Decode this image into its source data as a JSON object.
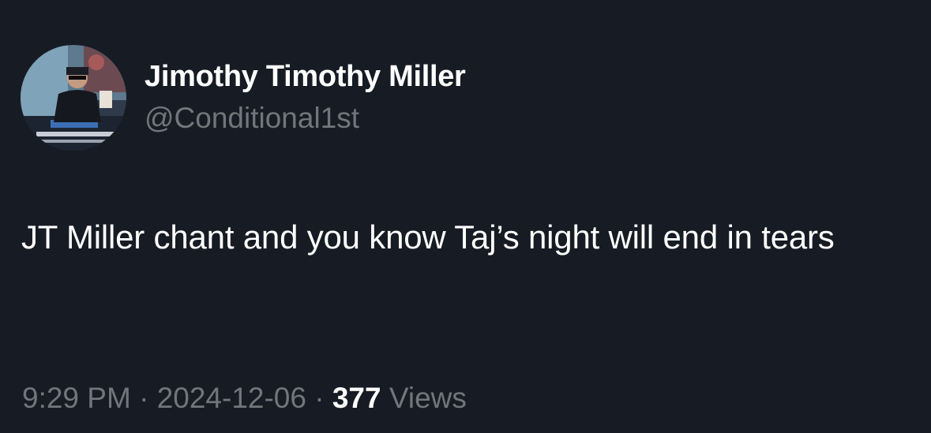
{
  "author": {
    "display_name": "Jimothy Timothy Miller",
    "handle": "@Conditional1st"
  },
  "tweet": {
    "text": "JT Miller chant and you know Taj’s night will end in tears"
  },
  "meta": {
    "time": "9:29 PM",
    "separator": "·",
    "date": "2024-12-06",
    "views_count": "377",
    "views_label": "Views"
  },
  "colors": {
    "background": "#171c24",
    "primary_text": "#ffffff",
    "secondary_text": "#71767b"
  },
  "icons": {
    "avatar": "profile-photo-avatar"
  }
}
